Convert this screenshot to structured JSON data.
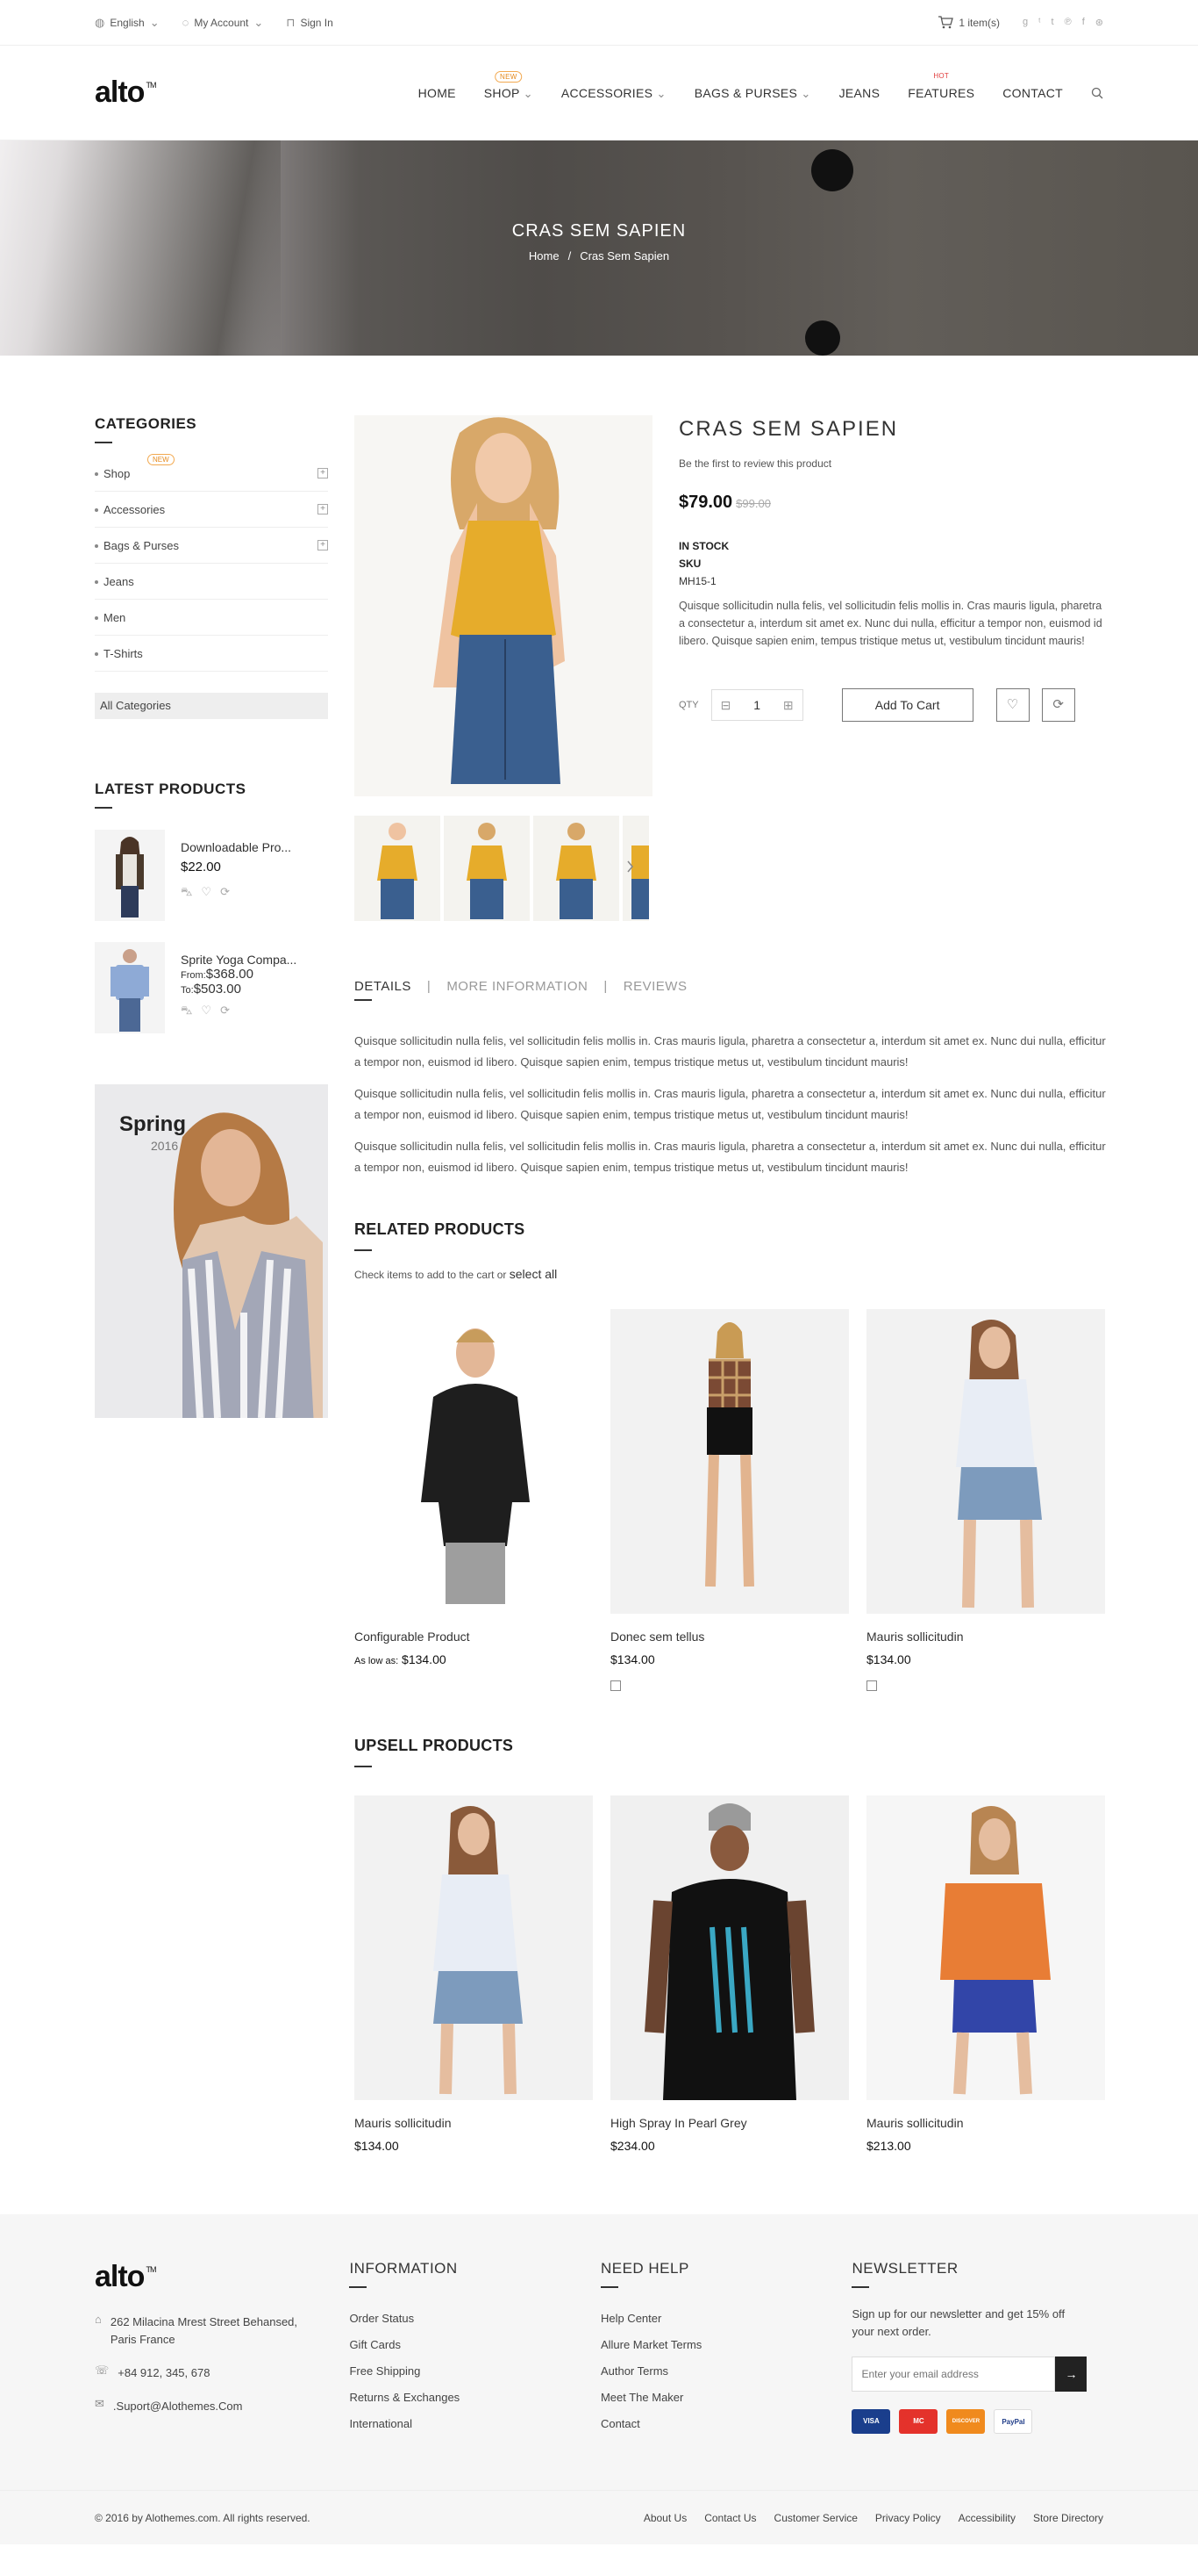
{
  "topbar": {
    "language": "English",
    "account": "My Account",
    "signin": "Sign In",
    "cart": "1 item(s)",
    "socials": [
      "g+",
      "tw",
      "tumblr",
      "pinterest",
      "facebook",
      "dribbble"
    ]
  },
  "header": {
    "logo": "alto",
    "logo_tm": "TM",
    "nav": [
      {
        "label": "HOME"
      },
      {
        "label": "SHOP",
        "badge": "NEW"
      },
      {
        "label": "ACCESSORIES"
      },
      {
        "label": "BAGS & PURSES"
      },
      {
        "label": "JEANS"
      },
      {
        "label": "FEATURES",
        "badge": "HOT"
      },
      {
        "label": "CONTACT"
      }
    ]
  },
  "hero": {
    "title": "CRAS SEM SAPIEN",
    "breadcrumb_home": "Home",
    "breadcrumb_sep": "/",
    "breadcrumb_current": "Cras Sem Sapien"
  },
  "sidebar": {
    "categories_title": "CATEGORIES",
    "categories": [
      {
        "label": "Shop",
        "badge": "NEW",
        "expandable": true
      },
      {
        "label": "Accessories",
        "expandable": true
      },
      {
        "label": "Bags & Purses",
        "expandable": true
      },
      {
        "label": "Jeans",
        "expandable": false
      },
      {
        "label": "Men",
        "expandable": false
      },
      {
        "label": "T-Shirts",
        "expandable": false
      }
    ],
    "all_categories": "All Categories",
    "latest_title": "LATEST PRODUCTS",
    "latest": [
      {
        "name": "Downloadable Pro...",
        "price": "$22.00"
      },
      {
        "name": "Sprite Yoga Compa...",
        "from_label": "From:",
        "from": "$368.00",
        "to_label": "To:",
        "to": "$503.00"
      }
    ],
    "banner_title": "Spring",
    "banner_year": "2016"
  },
  "product": {
    "title": "CRAS SEM SAPIEN",
    "review": "Be the first to review this product",
    "price": "$79.00",
    "old_price": "$99.00",
    "stock": "IN STOCK",
    "sku_label": "SKU",
    "sku": "MH15-1",
    "description": "Quisque sollicitudin nulla felis, vel sollicitudin felis mollis in. Cras mauris ligula, pharetra a consectetur a, interdum sit amet ex. Nunc dui nulla, efficitur a tempor non, euismod id libero. Quisque sapien enim, tempus tristique metus ut, vestibulum tincidunt mauris!",
    "qty_label": "QTY",
    "qty": "1",
    "add_to_cart": "Add To Cart"
  },
  "tabs": {
    "items": [
      "DETAILS",
      "MORE INFORMATION",
      "REVIEWS"
    ],
    "separator": "|",
    "paragraph": "Quisque sollicitudin nulla felis, vel sollicitudin felis mollis in. Cras mauris ligula, pharetra a consectetur a, interdum sit amet ex. Nunc dui nulla, efficitur a tempor non, euismod id libero. Quisque sapien enim, tempus tristique metus ut, vestibulum tincidunt mauris!"
  },
  "related": {
    "title": "RELATED PRODUCTS",
    "note": "Check items to add to the cart or",
    "select_all": "select all",
    "items": [
      {
        "name": "Configurable Product",
        "price_prefix": "As low as:",
        "price": "$134.00"
      },
      {
        "name": "Donec sem tellus",
        "price": "$134.00"
      },
      {
        "name": "Mauris sollicitudin",
        "price": "$134.00"
      }
    ]
  },
  "upsell": {
    "title": "UPSELL PRODUCTS",
    "items": [
      {
        "name": "Mauris sollicitudin",
        "price": "$134.00"
      },
      {
        "name": "High Spray In Pearl Grey",
        "price": "$234.00"
      },
      {
        "name": "Mauris sollicitudin",
        "price": "$213.00"
      }
    ]
  },
  "footer": {
    "address": "262 Milacina Mrest Street Behansed, Paris France",
    "phone": "+84 912, 345, 678",
    "email": ".Suport@Alothemes.Com",
    "info_title": "INFORMATION",
    "info_links": [
      "Order Status",
      "Gift Cards",
      "Free Shipping",
      "Returns & Exchanges",
      "International"
    ],
    "help_title": "NEED HELP",
    "help_links": [
      "Help Center",
      "Allure Market Terms",
      "Author Terms",
      "Meet The Maker",
      "Contact"
    ],
    "newsletter_title": "NEWSLETTER",
    "newsletter_text": "Sign up for our newsletter and get 15% off your next order.",
    "newsletter_placeholder": "Enter your email address",
    "payments": [
      "VISA",
      "MC",
      "DISCOVER",
      "PayPal"
    ]
  },
  "bottom": {
    "copyright": "© 2016 by Alothemes.com. All rights reserved.",
    "links": [
      "About Us",
      "Contact Us",
      "Customer Service",
      "Privacy Policy",
      "Accessibility",
      "Store Directory"
    ]
  },
  "colors": {
    "accent": "#e58a1e",
    "hot": "#e03b3b",
    "dark": "#222222"
  }
}
